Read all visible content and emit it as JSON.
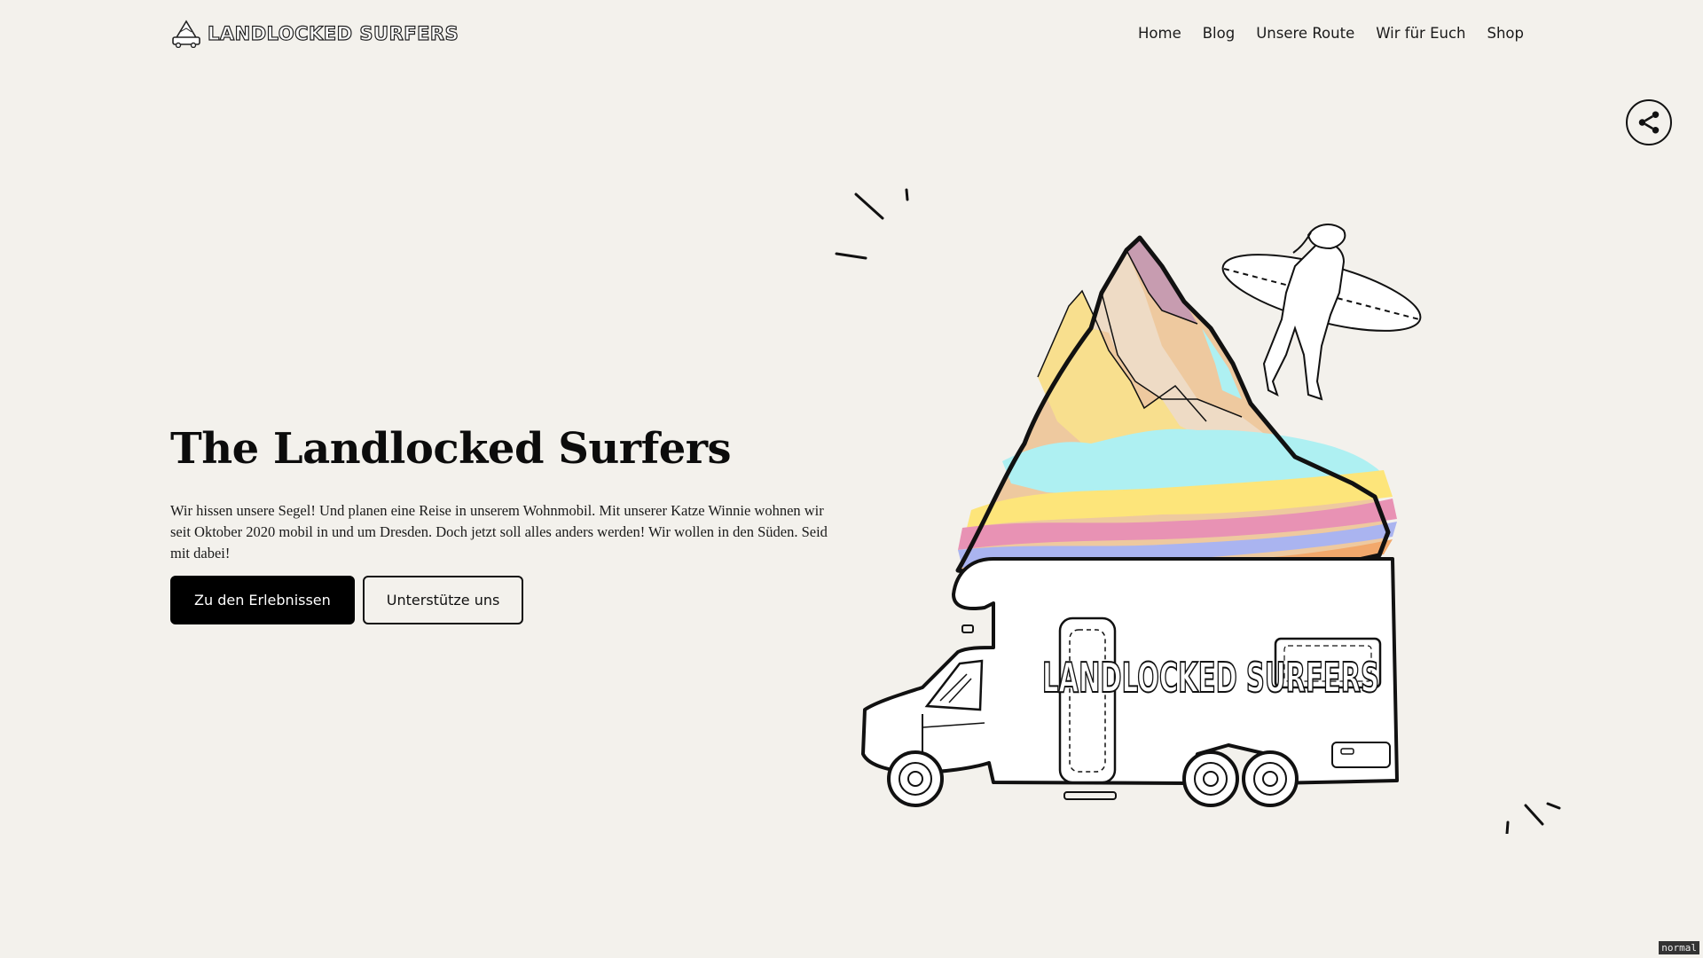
{
  "header": {
    "logo_text": "LANDLOCKED SURFERS",
    "nav": [
      "Home",
      "Blog",
      "Unsere Route",
      "Wir für Euch",
      "Shop"
    ]
  },
  "hero": {
    "title": "The Landlocked Surfers",
    "text": "Wir hissen unsere Segel! Und planen eine Reise in unserem Wohnmobil. Mit unserer Katze Winnie wohnen wir seit Oktober 2020 mobil in und um Dresden. Doch jetzt soll alles anders werden! Wir wollen in den Süden. Seid mit dabei!",
    "primary_button": "Zu den Erlebnissen",
    "secondary_button": "Unterstütze uns"
  },
  "illustration": {
    "van_text": "LANDLOCKED SURFERS"
  },
  "share": {
    "icon": "share-icon"
  },
  "status": {
    "mode": "normal"
  },
  "colors": {
    "background": "#f3f1ec",
    "primary_button": "#000000",
    "mountain_purple": "#c79cb0",
    "mountain_yellow": "#f8df8e",
    "mountain_peach": "#eec99f",
    "mountain_cyan": "#aef0f2",
    "mountain_pink": "#e892b4"
  }
}
